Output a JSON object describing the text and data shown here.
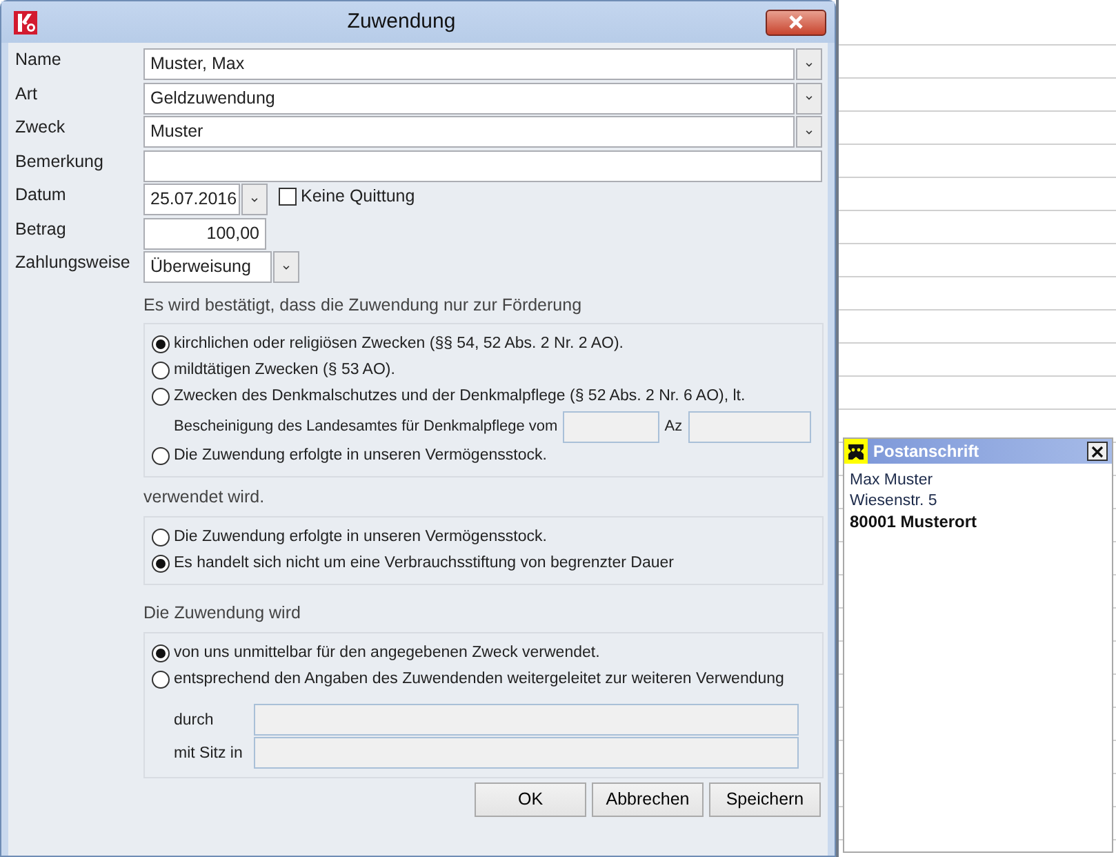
{
  "dialog": {
    "title": "Zuwendung",
    "fields": [
      {
        "label": "Name",
        "kind": "combo",
        "value": "Muster, Max"
      },
      {
        "label": "Art",
        "kind": "combo",
        "value": "Geldzuwendung"
      },
      {
        "label": "Zweck",
        "kind": "combo",
        "value": "Muster"
      },
      {
        "label": "Bemerkung",
        "kind": "text"
      },
      {
        "label": "Datum",
        "kind": "date",
        "value": "25.07.2016",
        "checkbox": {
          "label": "Keine Quittung",
          "checked": false
        }
      },
      {
        "label": "Betrag",
        "kind": "amount",
        "value": "100,00"
      },
      {
        "label": "Zahlungsweise",
        "kind": "choice",
        "value": "Überweisung"
      }
    ],
    "sections": [
      {
        "heading": "Es wird bestätigt, dass die Zuwendung nur zur Förderung",
        "options": [
          {
            "label": "kirchlichen oder religiösen Zwecken (§§ 54, 52 Abs. 2 Nr. 2 AO).",
            "selected": true
          },
          {
            "label": "mildtätigen Zwecken (§ 53 AO).",
            "selected": false
          },
          {
            "label": "Zwecken des Denkmalschutzes und der Denkmalpflege (§ 52 Abs. 2 Nr. 6 AO), lt.",
            "selected": false,
            "detail": {
              "label": "Bescheinigung des Landesamtes für Denkmalpflege vom",
              "second_label": "Az"
            }
          },
          {
            "label": "Die Zuwendung erfolgte in unseren Vermögensstock.",
            "selected": false
          }
        ]
      },
      {
        "heading": "verwendet wird.",
        "options": [
          {
            "label": "Die Zuwendung erfolgte in unseren Vermögensstock.",
            "selected": false
          },
          {
            "label": "Es handelt sich nicht um eine Verbrauchsstiftung von begrenzter Dauer",
            "selected": true
          }
        ]
      },
      {
        "heading": "Die Zuwendung wird",
        "options": [
          {
            "label": "von uns unmittelbar für den angegebenen Zweck verwendet.",
            "selected": true
          },
          {
            "label": "entsprechend den Angaben des Zuwendenden weitergeleitet zur weiteren Verwendung",
            "selected": false
          }
        ],
        "fields": [
          {
            "label": "durch"
          },
          {
            "label": "mit Sitz in"
          }
        ]
      }
    ],
    "buttons": [
      "OK",
      "Abbrechen",
      "Speichern"
    ]
  },
  "address_panel": {
    "title": "Postanschrift",
    "lines": [
      {
        "text": "Max Muster",
        "bold": false
      },
      {
        "text": "Wiesenstr. 5",
        "bold": false
      },
      {
        "text": "80001 Musterort",
        "bold": true
      }
    ]
  }
}
